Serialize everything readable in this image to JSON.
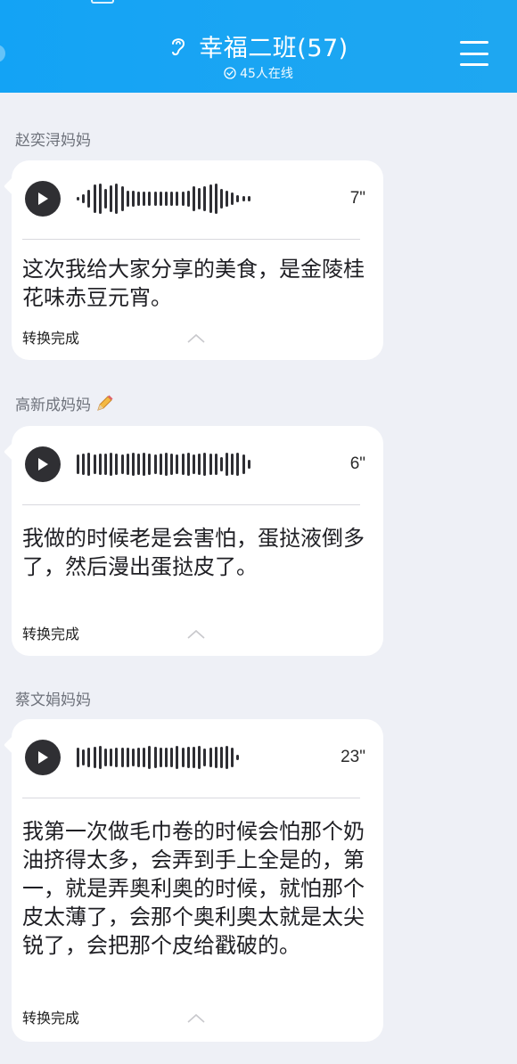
{
  "header": {
    "title": "幸福二班(57)",
    "online": "45人在线",
    "bg_color": "#1aa5f3"
  },
  "icons": {
    "hearing": "ear-icon",
    "online": "check-circle-icon",
    "menu": "menu-icon",
    "play": "play-icon",
    "collapse": "chevron-up-icon",
    "pen": "pen-icon"
  },
  "messages": [
    {
      "sender": "赵奕浔妈妈",
      "duration": "7\"",
      "transcript": "这次我给大家分享的美食，是金陵桂花味赤豆元宵。",
      "status": "转换完成"
    },
    {
      "sender": "高新成妈妈",
      "duration": "6\"",
      "transcript": "我做的时候老是会害怕，蛋挞液倒多了，然后漫出蛋挞皮了。",
      "status": "转换完成"
    },
    {
      "sender": "蔡文娟妈妈",
      "duration": "23\"",
      "transcript": "我第一次做毛巾卷的时候会怕那个奶油挤得太多，会弄到手上全是的，第一，就是弄奥利奥的时候，就怕那个皮太薄了，会那个奥利奥太就是太尖锐了，会把那个皮给戳破的。",
      "status": "转换完成"
    }
  ]
}
